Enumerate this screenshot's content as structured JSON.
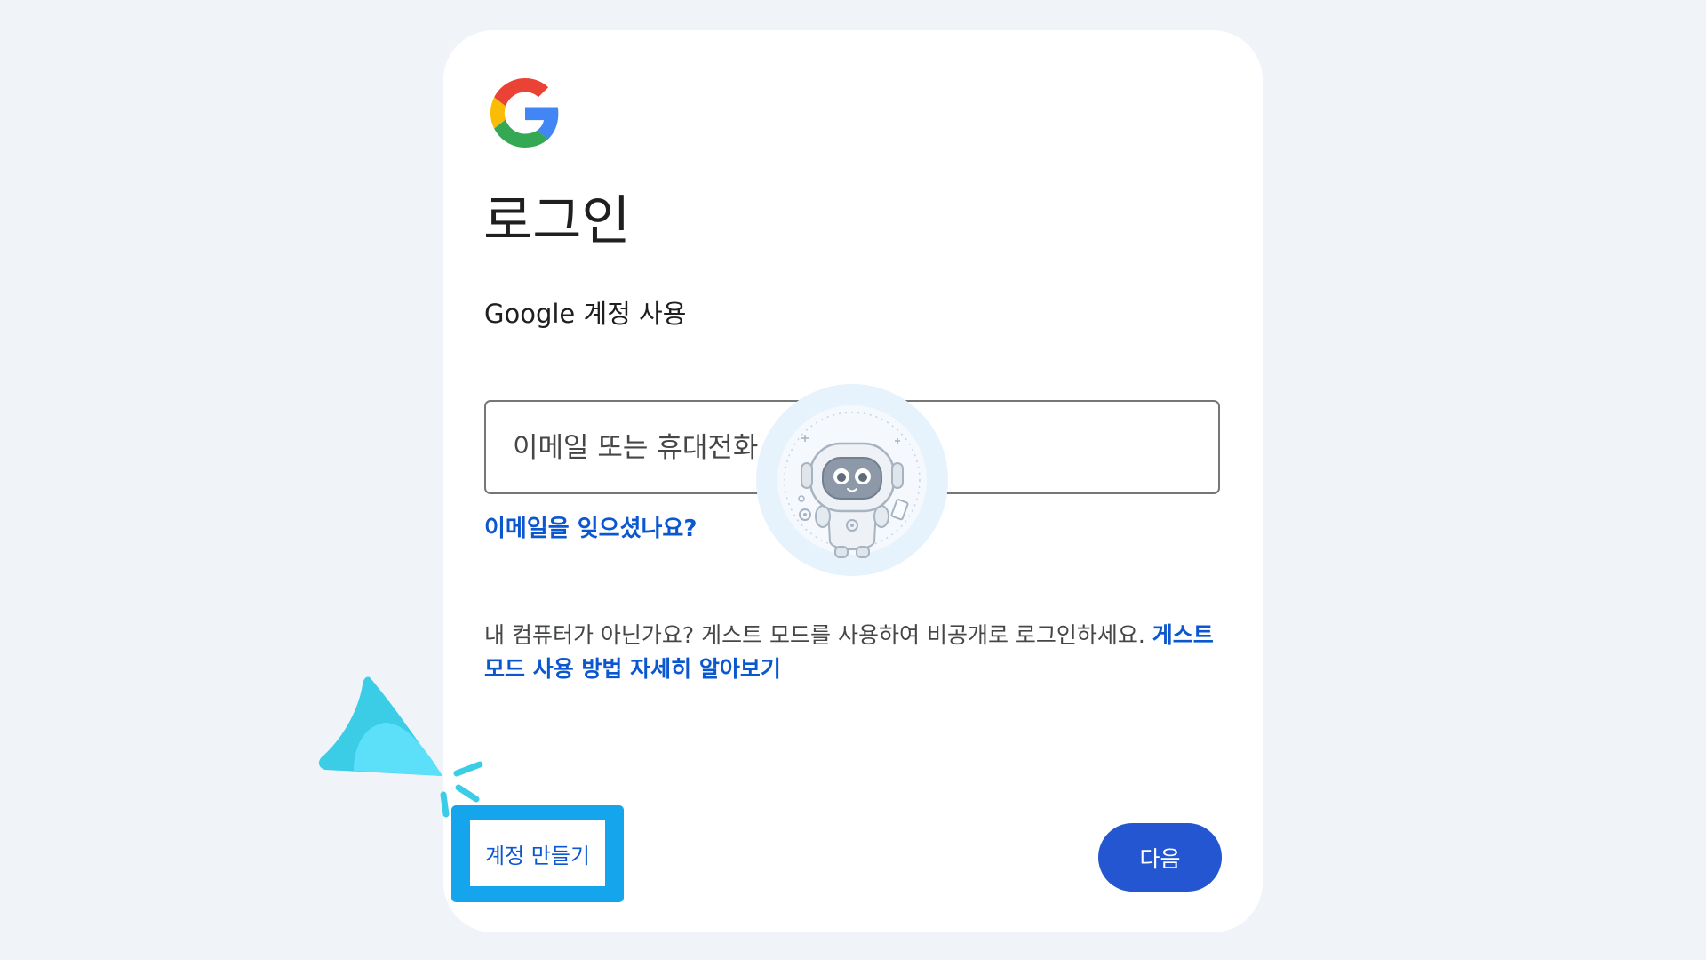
{
  "login": {
    "title": "로그인",
    "subtitle": "Google 계정 사용",
    "email_placeholder": "이메일 또는 휴대전화",
    "forgot_email": "이메일을 잊으셨나요?",
    "guest_text": "내 컴퓨터가 아닌가요? 게스트 모드를 사용하여 비공개로 로그인하세요. ",
    "guest_link": "게스트 모드 사용 방법 자세히 알아보기",
    "create_account": "계정 만들기",
    "next": "다음"
  },
  "icons": {
    "logo": "google-g-logo",
    "pointer": "cursor-pointer-icon",
    "mascot": "robot-mascot-icon"
  },
  "colors": {
    "background": "#f0f4f9",
    "card": "#ffffff",
    "link": "#0b57d0",
    "primary_button": "#2356d0",
    "highlight": "#15a5ed"
  }
}
